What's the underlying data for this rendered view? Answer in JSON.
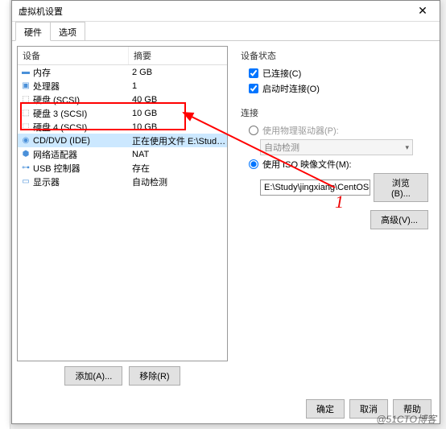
{
  "window": {
    "title": "虚拟机设置"
  },
  "tabs": {
    "hardware": "硬件",
    "options": "选项"
  },
  "list": {
    "headers": {
      "device": "设备",
      "summary": "摘要"
    },
    "rows": [
      {
        "icon": "memory",
        "name": "内存",
        "summary": "2 GB"
      },
      {
        "icon": "cpu",
        "name": "处理器",
        "summary": "1"
      },
      {
        "icon": "disk",
        "name": "硬盘 (SCSI)",
        "summary": "40 GB"
      },
      {
        "icon": "disk",
        "name": "硬盘 3 (SCSI)",
        "summary": "10 GB"
      },
      {
        "icon": "disk",
        "name": "硬盘 4 (SCSI)",
        "summary": "10 GB"
      },
      {
        "icon": "cd",
        "name": "CD/DVD (IDE)",
        "summary": "正在使用文件 E:\\Study\\jingxian..."
      },
      {
        "icon": "net",
        "name": "网络适配器",
        "summary": "NAT"
      },
      {
        "icon": "usb",
        "name": "USB 控制器",
        "summary": "存在"
      },
      {
        "icon": "display",
        "name": "显示器",
        "summary": "自动检测"
      }
    ]
  },
  "buttons": {
    "add": "添加(A)...",
    "remove": "移除(R)",
    "browse": "浏览(B)...",
    "advanced": "高级(V)...",
    "ok": "确定",
    "cancel": "取消",
    "help": "帮助"
  },
  "right": {
    "status_title": "设备状态",
    "connected": "已连接(C)",
    "connect_at_power": "启动时连接(O)",
    "connection_title": "连接",
    "use_physical": "使用物理驱动器(P):",
    "auto_detect": "自动检测",
    "use_iso": "使用 ISO 映像文件(M):",
    "iso_path": "E:\\Study\\jingxiang\\CentOS-"
  },
  "annotation": {
    "num": "1"
  },
  "watermark": "@51CTO博客"
}
